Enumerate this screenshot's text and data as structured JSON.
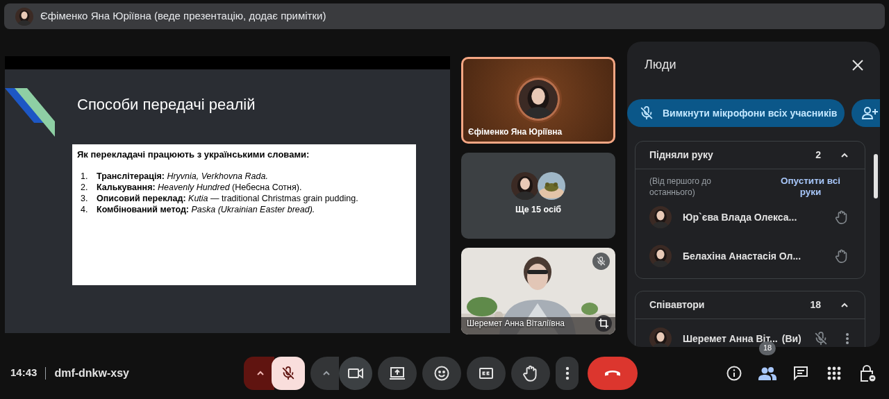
{
  "top_banner": {
    "presenter": "Єфіменко Яна Юріївна (веде презентацію, додає примітки)"
  },
  "slide": {
    "title": "Способи передачі реалій",
    "box_heading": "Як перекладачі працюють з українськими словами:",
    "items": [
      {
        "number": "1.",
        "text": "**Транслітерація:** *Hryvnia, Verkhovna Rada.*"
      },
      {
        "number": "2.",
        "text": "**Калькування:** *Heavenly Hundred* (Небесна Сотня)."
      },
      {
        "number": "3.",
        "text": "**Описовий переклад:** *Kutia* — traditional Christmas grain pudding."
      },
      {
        "number": "4.",
        "text": "**Комбінований метод:** *Paska (Ukrainian Easter bread).*"
      }
    ]
  },
  "tiles": [
    {
      "kind": "speaker",
      "name": "Єфіменко Яна Юріївна",
      "speaking": true
    },
    {
      "kind": "others",
      "label": "Ще 15 осіб"
    },
    {
      "kind": "video",
      "name": "Шеремет Анна Віталіївна",
      "muted": true
    }
  ],
  "people_panel": {
    "title": "Люди",
    "mute_all": "Вимкнути мікрофони всіх учасників",
    "sections": [
      {
        "title": "Підняли руку",
        "count": "2",
        "expanded": true,
        "note": "(Від першого до останнього)",
        "action": "Опустити всі руки",
        "people": [
          {
            "kind": "raised",
            "name": "Юр`єва Влада Олекса..."
          },
          {
            "kind": "raised",
            "name": "Белахіна Анастасія Ол..."
          }
        ]
      },
      {
        "title": "Співавтори",
        "count": "18",
        "expanded": true,
        "people": [
          {
            "kind": "self",
            "name": "Шеремет Анна Віт...",
            "suffix": "(Ви)",
            "muted": true
          }
        ]
      }
    ]
  },
  "bottom_bar": {
    "time": "14:43",
    "meeting_code": "dmf-dnkw-xsy",
    "controls": [
      {
        "kind": "mic",
        "on": false
      },
      {
        "kind": "camera",
        "on": true
      },
      {
        "kind": "present"
      },
      {
        "kind": "emoji"
      },
      {
        "kind": "captions"
      },
      {
        "kind": "hand"
      },
      {
        "kind": "more"
      },
      {
        "kind": "leave"
      }
    ],
    "side_buttons": [
      {
        "kind": "info",
        "selected": false
      },
      {
        "kind": "people",
        "selected": true,
        "badge": "18"
      },
      {
        "kind": "chat",
        "selected": false
      },
      {
        "kind": "apps",
        "selected": false
      },
      {
        "kind": "host",
        "selected": false
      }
    ]
  }
}
